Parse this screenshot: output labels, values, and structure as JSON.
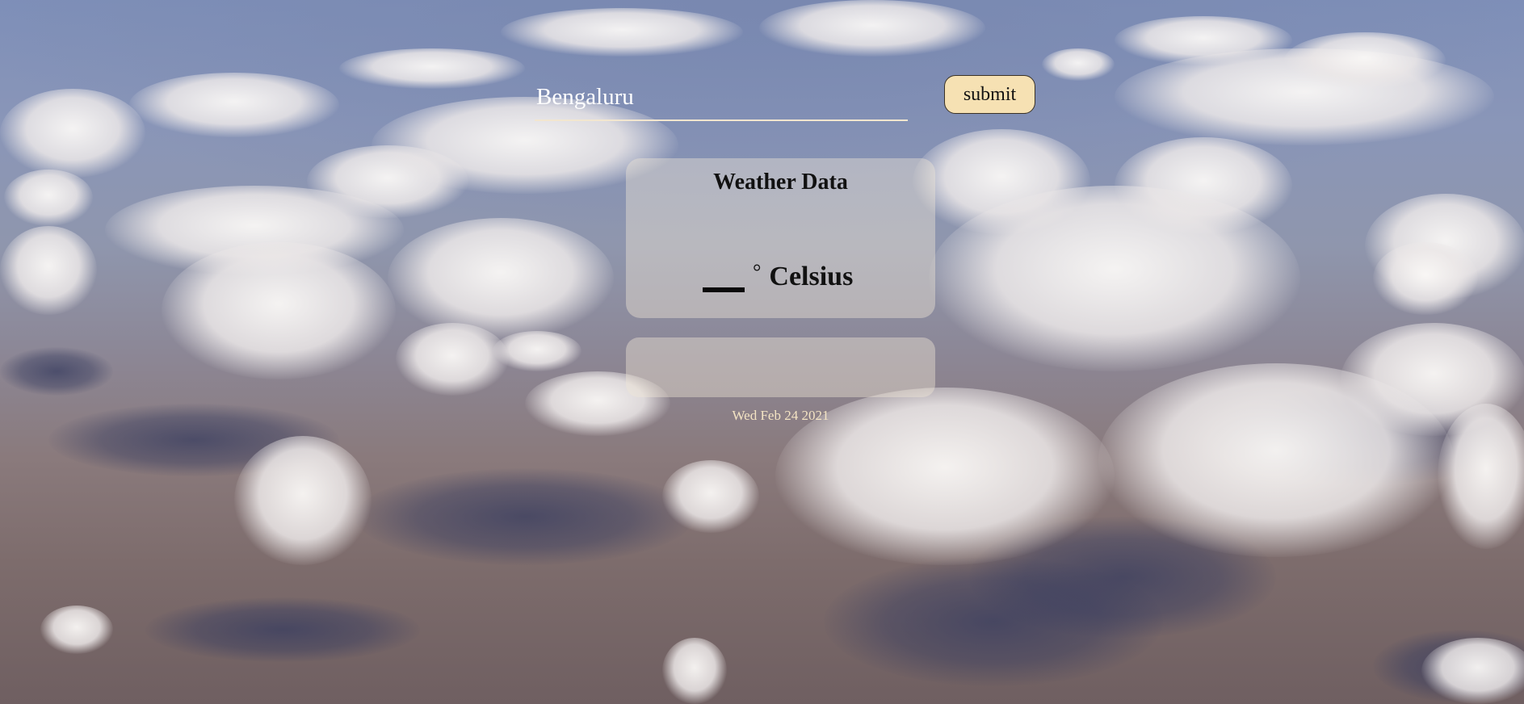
{
  "search": {
    "value": "Bengaluru",
    "submit_label": "submit"
  },
  "weather_card": {
    "title": "Weather Data",
    "degree_symbol": "°",
    "unit": "Celsius"
  },
  "footer": {
    "date": "Wed Feb 24 2021"
  },
  "colors": {
    "button_bg": "#f6e1b3",
    "input_underline": "#f2e6cf",
    "date_text": "#f4e4c4",
    "card_bg": "rgba(240,232,215,0.42)"
  }
}
